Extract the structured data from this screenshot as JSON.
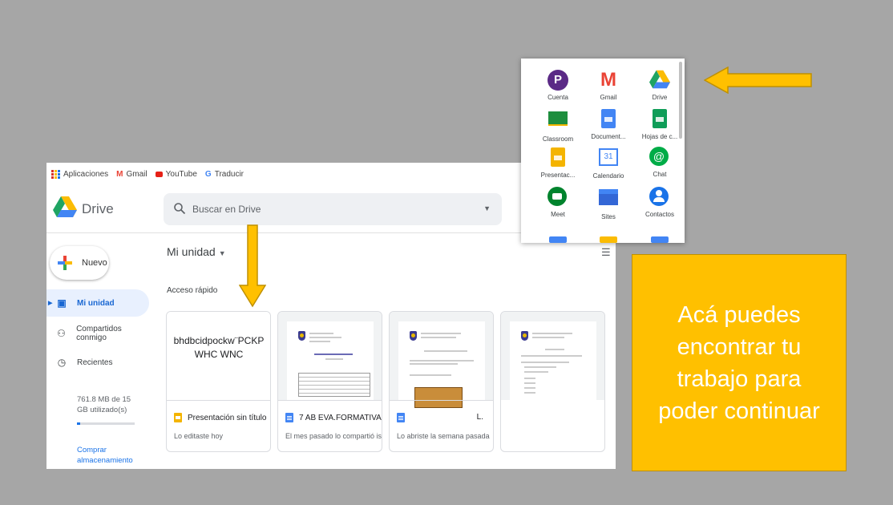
{
  "bookmarks": [
    {
      "label": "Aplicaciones",
      "icon": "apps-grid-icon"
    },
    {
      "label": "Gmail",
      "icon": "gmail-icon"
    },
    {
      "label": "YouTube",
      "icon": "youtube-icon"
    },
    {
      "label": "Traducir",
      "icon": "translate-icon"
    }
  ],
  "header": {
    "brand": "Drive",
    "search_placeholder": "Buscar en Drive"
  },
  "sidebar": {
    "new_label": "Nuevo",
    "items": [
      {
        "label": "Mi unidad",
        "icon": "drive-folder-icon",
        "active": true
      },
      {
        "label": "Compartidos conmigo",
        "icon": "shared-people-icon",
        "active": false
      },
      {
        "label": "Recientes",
        "icon": "clock-icon",
        "active": false
      }
    ],
    "storage_text": "761.8 MB de 15 GB utilizado(s)",
    "storage_fraction": 0.05,
    "buy_label": "Comprar almacenamiento"
  },
  "main": {
    "title": "Mi unidad",
    "quick_access": "Acceso rápido",
    "cards": [
      {
        "thumb_text": "bhdbcidpockw¨PCKPWHC WNC",
        "type": "slides",
        "name": "Presentación sin título",
        "meta": "Lo editaste hoy",
        "extra": ""
      },
      {
        "thumb_text": "",
        "type": "docs",
        "name": "7 AB EVA.FORMATIVA",
        "meta": "El mes pasado lo compartió isido...",
        "extra": ""
      },
      {
        "thumb_text": "",
        "type": "docs",
        "name": "",
        "meta": "Lo abriste la semana pasada",
        "extra": "L."
      },
      {
        "thumb_text": "",
        "type": "none",
        "name": "",
        "meta": "",
        "extra": ""
      }
    ]
  },
  "apps_panel": {
    "apps": [
      {
        "label": "Cuenta",
        "icon": "account-icon",
        "color": "#5b2a86"
      },
      {
        "label": "Gmail",
        "icon": "gmail-icon",
        "color": "#ea4335"
      },
      {
        "label": "Drive",
        "icon": "drive-icon",
        "color": "#1fa463"
      },
      {
        "label": "Classroom",
        "icon": "classroom-icon",
        "color": "#1e8e3e"
      },
      {
        "label": "Document...",
        "icon": "docs-icon",
        "color": "#4285f4"
      },
      {
        "label": "Hojas de c...",
        "icon": "sheets-icon",
        "color": "#0f9d58"
      },
      {
        "label": "Presentac...",
        "icon": "slides-icon",
        "color": "#f4b400"
      },
      {
        "label": "Calendario",
        "icon": "calendar-icon",
        "color": "#4285f4"
      },
      {
        "label": "Chat",
        "icon": "chat-icon",
        "color": "#00ac47"
      },
      {
        "label": "Meet",
        "icon": "meet-icon",
        "color": "#00832d"
      },
      {
        "label": "Sites",
        "icon": "sites-icon",
        "color": "#3367d6"
      },
      {
        "label": "Contactos",
        "icon": "contacts-icon",
        "color": "#1a73e8"
      }
    ],
    "calendar_day": "31"
  },
  "callout": {
    "text": "Acá puedes encontrar tu trabajo para poder continuar"
  },
  "colors": {
    "background": "#a6a6a6",
    "accent": "#ffc000",
    "drive_blue": "#1a73e8"
  }
}
